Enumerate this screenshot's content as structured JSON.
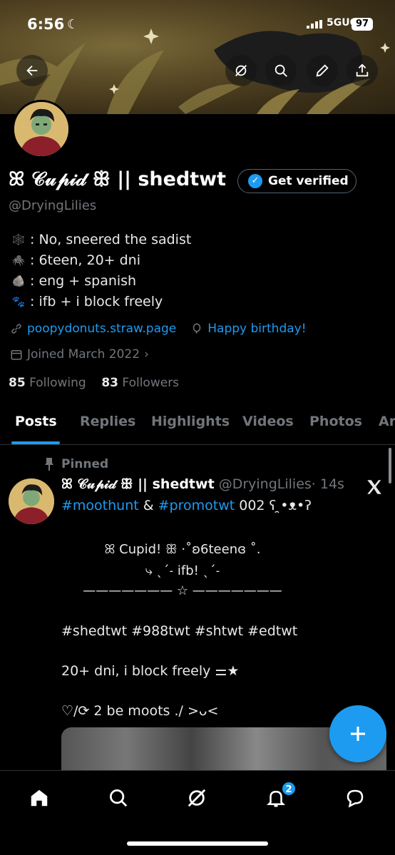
{
  "status_bar": {
    "time": "6:56",
    "network": "5GUC",
    "battery": "97"
  },
  "profile": {
    "display_name": "ꕤ 𝒞𝓊𝓅𝒾𝒹 ꕥ || shedtwt",
    "verify_label": "Get verified",
    "handle": "@DryingLilies",
    "bio": [
      {
        "emoji": "🕸️",
        "text": ": No, sneered the sadist"
      },
      {
        "emoji": "🕷️",
        "text": ": 6teen, 20+ dni"
      },
      {
        "emoji": "🪨",
        "text": ": eng + spanish"
      },
      {
        "emoji": "🐾",
        "text": ": ifb + i block freely"
      }
    ],
    "website": "poopydonuts.straw.page",
    "birthday": "Happy birthday!",
    "joined": "Joined March 2022",
    "following_count": "85",
    "following_label": "Following",
    "followers_count": "83",
    "followers_label": "Followers"
  },
  "tabs": [
    "Posts",
    "Replies",
    "Highlights",
    "Videos",
    "Photos",
    "Ar"
  ],
  "post": {
    "pinned_label": "Pinned",
    "author_name": "ꕤ 𝒞𝓊𝓅𝒾𝒹 ꕥ || shedtwt",
    "author_handle": "@DryingLilies",
    "time": "· 14s",
    "hashtag1": "#moothunt",
    "amp": " & ",
    "hashtag2": "#promotwt",
    "tag_suffix": " 002 ʕ ̯•ᴥ•ʔ",
    "line1": "ꕤ Cupid! ꕥ ·˚ʚ6teenɞ ˚.",
    "line2": "⤷ ˎˊ˗  ifb! ˎˊ˗",
    "line3": "——————— ☆ ———————",
    "hashtags": "#shedtwt #988twt #shtwt #edtwt",
    "line4": "20+ dni, i block freely ⚌★",
    "line5": "♡/⟳ 2 be moots ./ >ᴗ<"
  },
  "nav": {
    "notification_count": "2"
  }
}
